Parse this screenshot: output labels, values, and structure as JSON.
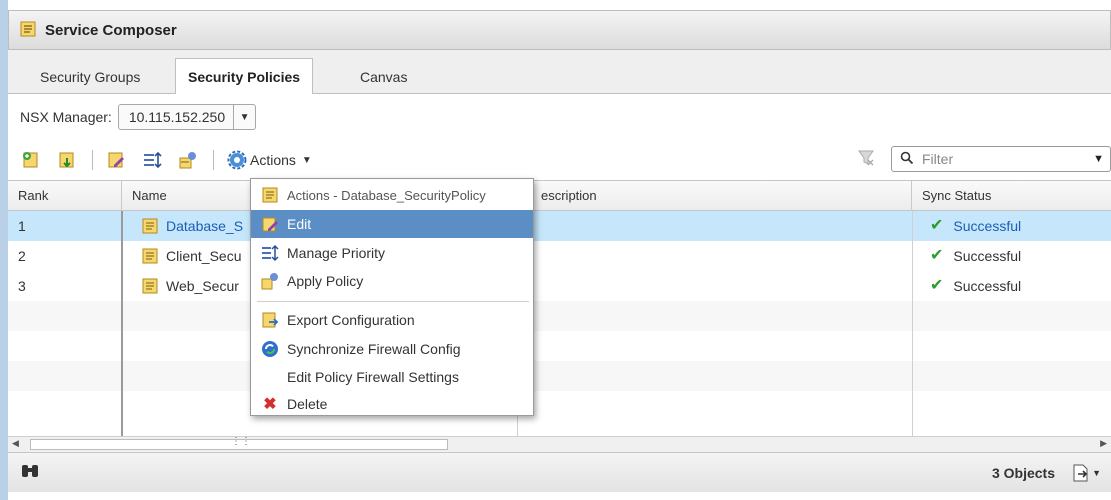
{
  "window": {
    "title": "Service Composer"
  },
  "tabs": [
    {
      "label": "Security Groups",
      "active": false
    },
    {
      "label": "Security Policies",
      "active": true
    },
    {
      "label": "Canvas",
      "active": false
    }
  ],
  "nsx_manager": {
    "label": "NSX Manager:",
    "value": "10.115.152.250"
  },
  "toolbar": {
    "actions_label": "Actions"
  },
  "filter": {
    "placeholder": "Filter"
  },
  "table": {
    "columns": [
      "Rank",
      "Name",
      "Description",
      "Sync Status"
    ],
    "rows": [
      {
        "rank": "1",
        "name": "Database_S",
        "sync": "Successful"
      },
      {
        "rank": "2",
        "name": "Client_Secu",
        "sync": "Successful"
      },
      {
        "rank": "3",
        "name": "Web_Secur",
        "sync": "Successful"
      }
    ],
    "description_visible": "escription"
  },
  "context_menu": {
    "header": "Actions - Database_SecurityPolicy",
    "items": [
      {
        "label": "Edit",
        "icon": "edit-icon"
      },
      {
        "label": "Manage Priority",
        "icon": "priority-icon"
      },
      {
        "label": "Apply Policy",
        "icon": "apply-policy-icon"
      },
      {
        "label": "Export Configuration",
        "icon": "export-icon"
      },
      {
        "label": "Synchronize Firewall Config",
        "icon": "sync-icon"
      },
      {
        "label": "Edit Policy Firewall Settings",
        "icon": ""
      },
      {
        "label": "Delete",
        "icon": "delete-icon"
      }
    ]
  },
  "footer": {
    "objects_count": "3 Objects"
  },
  "colors": {
    "accent": "#5b8ec4",
    "link": "#1a5fb4",
    "selected_row": "#c5e6fb",
    "success": "#2e9b2e",
    "delete": "#d32f2f"
  }
}
